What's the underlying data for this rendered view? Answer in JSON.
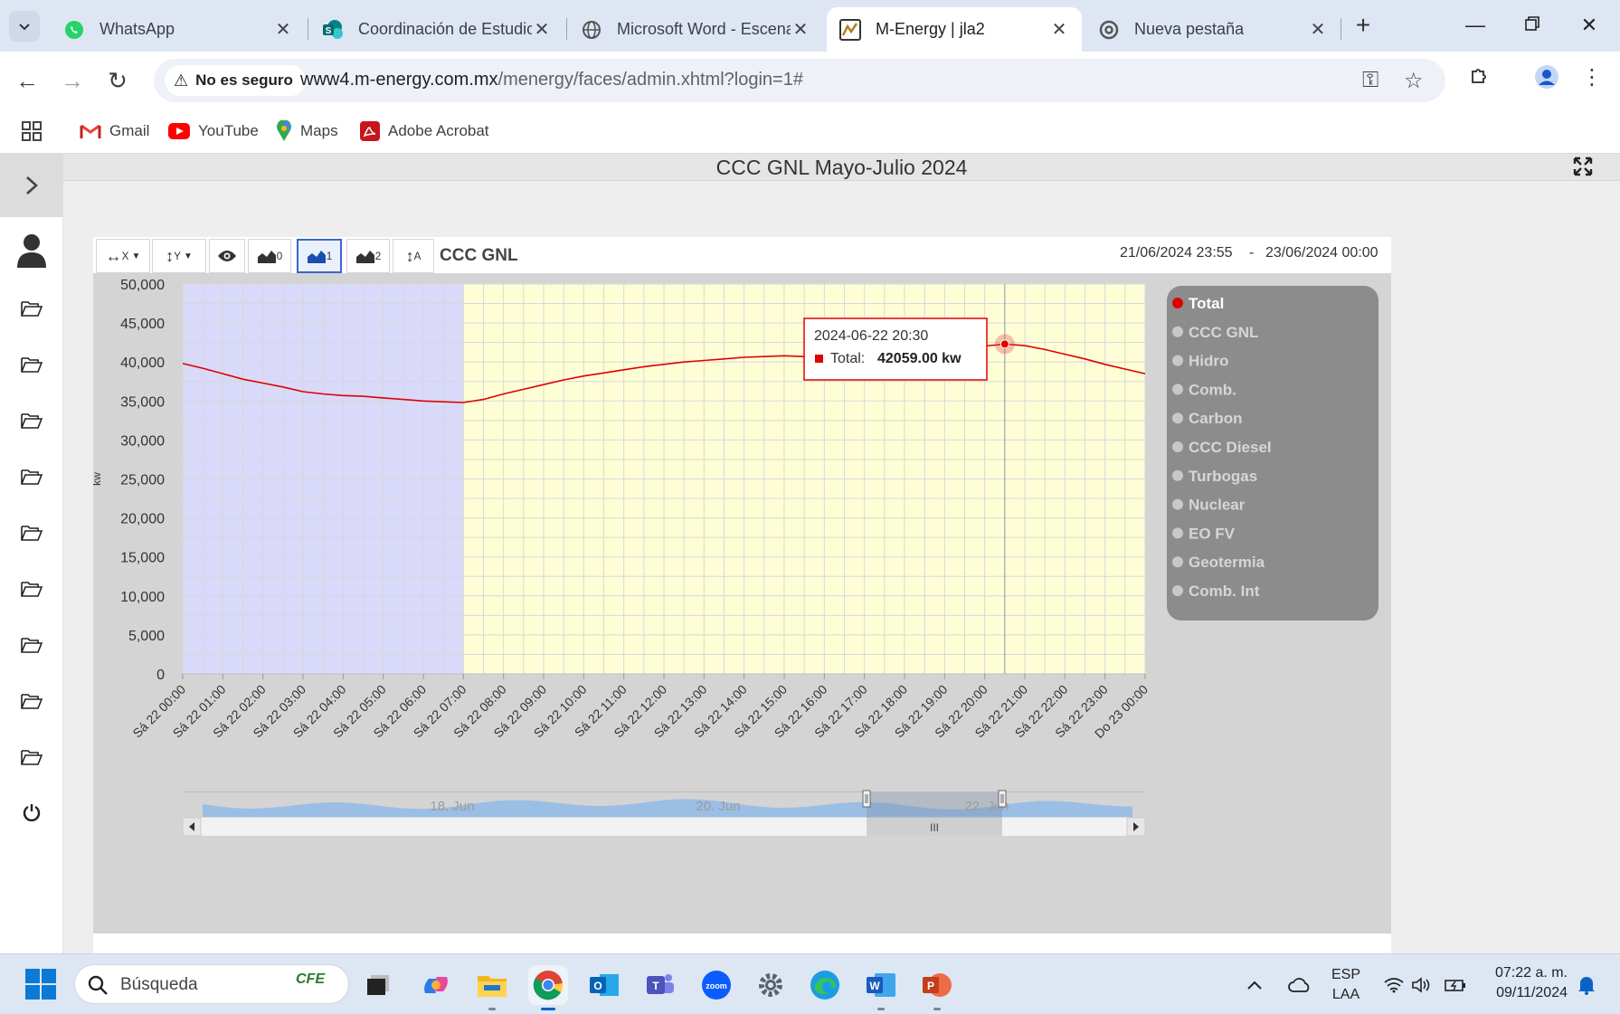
{
  "browser": {
    "tabs": [
      {
        "title": "WhatsApp",
        "icon": "whatsapp-icon",
        "active": false
      },
      {
        "title": "Coordinación de Estudios",
        "icon": "sharepoint-icon",
        "active": false
      },
      {
        "title": "Microsoft Word - Escenar",
        "icon": "globe-icon",
        "active": false
      },
      {
        "title": "M-Energy | jla2",
        "icon": "menergy-icon",
        "active": true
      },
      {
        "title": "Nueva pestaña",
        "icon": "chrome-icon",
        "active": false
      }
    ],
    "security_label": "No es seguro",
    "url_host": "www4.m-energy.com.mx",
    "url_path": "/menergy/faces/admin.xhtml?login=1#",
    "bookmarks": [
      "Gmail",
      "YouTube",
      "Maps",
      "Adobe Acrobat"
    ]
  },
  "page": {
    "title": "CCC GNL Mayo-Julio 2024"
  },
  "chart_toolbar": {
    "x_label": "X",
    "y_label": "Y",
    "stack0": "0",
    "stack1": "1",
    "stack2": "2",
    "auto_label": "A",
    "series_title": "CCC GNL",
    "date_from": "21/06/2024 23:55",
    "date_sep": "-",
    "date_to": "23/06/2024 00:00"
  },
  "tooltip": {
    "time": "2024-06-22 20:30",
    "series": "Total:",
    "value": "42059.00 kw"
  },
  "navigator": {
    "labels": [
      "18. Jun",
      "20. Jun",
      "22. Jun"
    ],
    "scroll_grip": "III"
  },
  "chart_data": {
    "type": "line",
    "ylabel": "kw",
    "ylim": [
      0,
      50000
    ],
    "yticks": [
      "50,000",
      "45,000",
      "40,000",
      "35,000",
      "30,000",
      "25,000",
      "20,000",
      "15,000",
      "10,000",
      "5,000",
      "0"
    ],
    "xticks": [
      "Sá 22 00:00",
      "Sá 22 01:00",
      "Sá 22 02:00",
      "Sá 22 03:00",
      "Sá 22 04:00",
      "Sá 22 05:00",
      "Sá 22 06:00",
      "Sá 22 07:00",
      "Sá 22 08:00",
      "Sá 22 09:00",
      "Sá 22 10:00",
      "Sá 22 11:00",
      "Sá 22 12:00",
      "Sá 22 13:00",
      "Sá 22 14:00",
      "Sá 22 15:00",
      "Sá 22 16:00",
      "Sá 22 17:00",
      "Sá 22 18:00",
      "Sá 22 19:00",
      "Sá 22 20:00",
      "Sá 22 21:00",
      "Sá 22 22:00",
      "Sá 22 23:00",
      "Do 23 00:00"
    ],
    "x_hours": [
      0,
      0.5,
      1,
      1.5,
      2,
      2.5,
      3,
      3.5,
      4,
      4.5,
      5,
      5.5,
      6,
      6.5,
      7,
      7.5,
      8,
      8.5,
      9,
      9.5,
      10,
      10.5,
      11,
      11.5,
      12,
      12.5,
      13,
      13.5,
      14,
      14.5,
      15,
      15.5,
      16,
      16.5,
      17,
      17.5,
      18,
      18.5,
      19,
      19.5,
      20,
      20.5,
      21,
      21.5,
      22,
      22.5,
      23,
      23.5,
      24
    ],
    "series": [
      {
        "name": "Total",
        "color": "#e00000",
        "values": [
          39800,
          39200,
          38500,
          37800,
          37300,
          36800,
          36200,
          35900,
          35700,
          35600,
          35400,
          35200,
          35000,
          34900,
          34800,
          35200,
          35900,
          36500,
          37100,
          37700,
          38200,
          38600,
          39000,
          39400,
          39700,
          40000,
          40200,
          40400,
          40600,
          40700,
          40800,
          40700,
          40600,
          40800,
          41000,
          41200,
          41500,
          41700,
          41900,
          42000,
          42059,
          42300,
          42100,
          41600,
          41000,
          40400,
          39700,
          39100,
          38500
        ]
      }
    ],
    "shaded_bands": [
      {
        "from_hour": 0,
        "to_hour": 7,
        "color": "#d9d9fa"
      },
      {
        "from_hour": 7,
        "to_hour": 24,
        "color": "#fefed6"
      }
    ],
    "highlight_hour": 20.5,
    "legend": {
      "placement": "right",
      "items": [
        {
          "name": "Total",
          "active": true
        },
        {
          "name": "CCC GNL",
          "active": false
        },
        {
          "name": "Hidro",
          "active": false
        },
        {
          "name": "Comb.",
          "active": false
        },
        {
          "name": "Carbon",
          "active": false
        },
        {
          "name": "CCC Diesel",
          "active": false
        },
        {
          "name": "Turbogas",
          "active": false
        },
        {
          "name": "Nuclear",
          "active": false
        },
        {
          "name": "EO FV",
          "active": false
        },
        {
          "name": "Geotermia",
          "active": false
        },
        {
          "name": "Comb. Int",
          "active": false
        }
      ]
    }
  },
  "taskbar": {
    "search_label": "Búsqueda",
    "cfe_badge": "CFE",
    "lang_top": "ESP",
    "lang_bottom": "LAA",
    "time": "07:22 a. m.",
    "date": "09/11/2024",
    "zoom_label": "zoom"
  }
}
